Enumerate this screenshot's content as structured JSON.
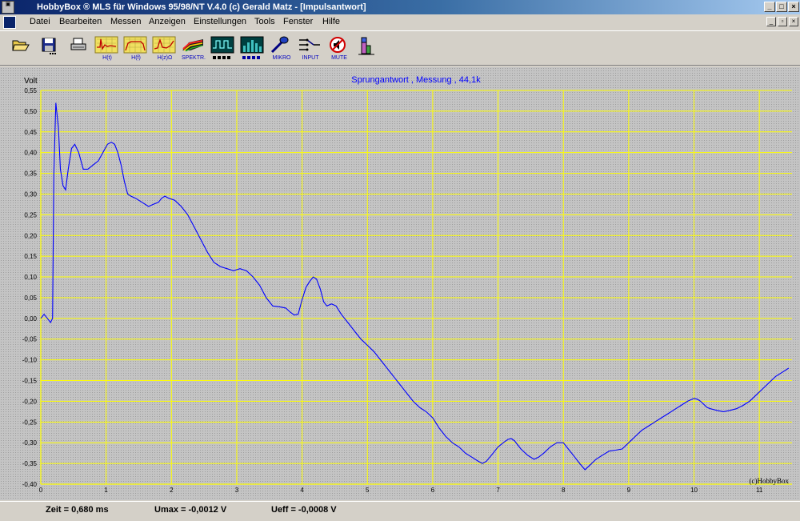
{
  "window": {
    "title": "HobbyBox ® MLS für Windows 95/98/NT   V.4.0    (c)  Gerald Matz - [Impulsantwort]",
    "min_glyph": "_",
    "max_glyph": "□",
    "close_glyph": "×"
  },
  "menu": {
    "items": [
      "Datei",
      "Bearbeiten",
      "Messen",
      "Anzeigen",
      "Einstellungen",
      "Tools",
      "Fenster",
      "Hilfe"
    ],
    "mdi_min": "_",
    "mdi_restore": "▫",
    "mdi_close": "×"
  },
  "toolbar": {
    "icons": [
      "open-folder-icon",
      "save-disk-icon",
      "print-icon",
      "impulse-response-icon",
      "frequency-response-icon",
      "impedance-icon",
      "spectrum-icon",
      "oscilloscope-icon",
      "analyzer-bars-icon",
      "microphone-icon",
      "input-icon",
      "mute-icon",
      "level-meter-icon"
    ],
    "labels": {
      "ht": "H(t)",
      "hf": "H(f)",
      "hz": "H(z)Ω",
      "spektr": "SPEKTR.",
      "mikro": "MIKRO",
      "input": "INPUT",
      "mute": "MUTE"
    }
  },
  "chart_data": {
    "type": "line",
    "title": "Sprungantwort , Messung , 44,1k",
    "ylabel": "Volt",
    "xlabel": "",
    "xlim": [
      0,
      11.5
    ],
    "ylim": [
      -0.4,
      0.55
    ],
    "x_ticks": [
      0,
      1,
      2,
      3,
      4,
      5,
      6,
      7,
      8,
      9,
      10,
      11
    ],
    "x_tick_labels": [
      "0",
      "1",
      "2",
      "3",
      "4",
      "5",
      "6",
      "7",
      "8",
      "9",
      "10",
      "11"
    ],
    "y_ticks": [
      0.55,
      0.5,
      0.45,
      0.4,
      0.35,
      0.3,
      0.25,
      0.2,
      0.15,
      0.1,
      0.05,
      0.0,
      -0.05,
      -0.1,
      -0.15,
      -0.2,
      -0.25,
      -0.3,
      -0.35,
      -0.4
    ],
    "y_tick_labels": [
      "0,55",
      "0,50",
      "0,45",
      "0,40",
      "0,35",
      "0,30",
      "0,25",
      "0,20",
      "0,15",
      "0,10",
      "0,05",
      "0,00",
      "-0,05",
      "-0,10",
      "-0,15",
      "-0,20",
      "-0,25",
      "-0,30",
      "-0,35",
      "-0,40"
    ],
    "grid": true,
    "colors": {
      "line": "#0000ff",
      "grid": "#ffff00",
      "text": "#000000",
      "title": "#0000ff"
    },
    "watermark": "(c)HobbyBox",
    "series": [
      {
        "x": [
          0,
          0.05,
          0.1,
          0.15,
          0.18,
          0.2,
          0.23,
          0.27,
          0.3,
          0.34,
          0.38,
          0.42,
          0.47,
          0.52,
          0.58,
          0.65,
          0.72,
          0.8,
          0.88,
          0.95,
          1.02,
          1.08,
          1.13,
          1.18,
          1.23,
          1.28,
          1.33,
          1.38,
          1.45,
          1.55,
          1.65,
          1.72,
          1.8,
          1.85,
          1.9,
          1.96,
          2.05,
          2.15,
          2.25,
          2.35,
          2.45,
          2.55,
          2.65,
          2.75,
          2.85,
          2.95,
          3.05,
          3.15,
          3.25,
          3.35,
          3.45,
          3.55,
          3.65,
          3.75,
          3.82,
          3.88,
          3.94,
          4.0,
          4.06,
          4.12,
          4.17,
          4.22,
          4.28,
          4.33,
          4.38,
          4.45,
          4.52,
          4.6,
          4.7,
          4.8,
          4.9,
          5.0,
          5.1,
          5.2,
          5.3,
          5.4,
          5.5,
          5.6,
          5.7,
          5.8,
          5.9,
          6.0,
          6.1,
          6.2,
          6.3,
          6.4,
          6.5,
          6.6,
          6.7,
          6.76,
          6.82,
          6.9,
          7.0,
          7.08,
          7.15,
          7.2,
          7.25,
          7.35,
          7.45,
          7.55,
          7.62,
          7.7,
          7.8,
          7.9,
          8.0,
          8.05,
          8.15,
          8.25,
          8.33,
          8.4,
          8.5,
          8.6,
          8.7,
          8.8,
          8.9,
          9.0,
          9.1,
          9.2,
          9.3,
          9.4,
          9.5,
          9.6,
          9.7,
          9.8,
          9.9,
          10.0,
          10.05,
          10.1,
          10.2,
          10.25,
          10.35,
          10.45,
          10.55,
          10.65,
          10.75,
          10.85,
          10.95,
          11.05,
          11.15,
          11.25,
          11.35,
          11.45
        ],
        "y": [
          0.0,
          0.01,
          0.0,
          -0.01,
          0.0,
          0.35,
          0.52,
          0.46,
          0.36,
          0.32,
          0.31,
          0.36,
          0.41,
          0.42,
          0.4,
          0.36,
          0.36,
          0.37,
          0.38,
          0.4,
          0.42,
          0.425,
          0.42,
          0.4,
          0.37,
          0.33,
          0.3,
          0.295,
          0.29,
          0.28,
          0.27,
          0.275,
          0.28,
          0.29,
          0.295,
          0.29,
          0.285,
          0.27,
          0.25,
          0.22,
          0.19,
          0.16,
          0.135,
          0.125,
          0.12,
          0.115,
          0.12,
          0.115,
          0.1,
          0.08,
          0.05,
          0.03,
          0.028,
          0.025,
          0.015,
          0.008,
          0.01,
          0.045,
          0.075,
          0.09,
          0.1,
          0.095,
          0.07,
          0.04,
          0.03,
          0.035,
          0.03,
          0.01,
          -0.01,
          -0.03,
          -0.05,
          -0.065,
          -0.08,
          -0.1,
          -0.12,
          -0.14,
          -0.16,
          -0.18,
          -0.2,
          -0.215,
          -0.225,
          -0.24,
          -0.265,
          -0.285,
          -0.3,
          -0.31,
          -0.325,
          -0.335,
          -0.345,
          -0.35,
          -0.345,
          -0.33,
          -0.31,
          -0.3,
          -0.292,
          -0.29,
          -0.295,
          -0.315,
          -0.33,
          -0.34,
          -0.335,
          -0.325,
          -0.31,
          -0.3,
          -0.3,
          -0.31,
          -0.33,
          -0.35,
          -0.365,
          -0.355,
          -0.34,
          -0.33,
          -0.32,
          -0.318,
          -0.315,
          -0.3,
          -0.285,
          -0.27,
          -0.26,
          -0.25,
          -0.24,
          -0.23,
          -0.22,
          -0.21,
          -0.2,
          -0.193,
          -0.195,
          -0.2,
          -0.215,
          -0.218,
          -0.222,
          -0.225,
          -0.222,
          -0.218,
          -0.21,
          -0.2,
          -0.185,
          -0.17,
          -0.155,
          -0.14,
          -0.13,
          -0.12
        ]
      }
    ]
  },
  "status": {
    "zeit": "Zeit = 0,680 ms",
    "umax": "Umax = -0,0012 V",
    "ueff": "Ueff = -0,0008 V"
  }
}
